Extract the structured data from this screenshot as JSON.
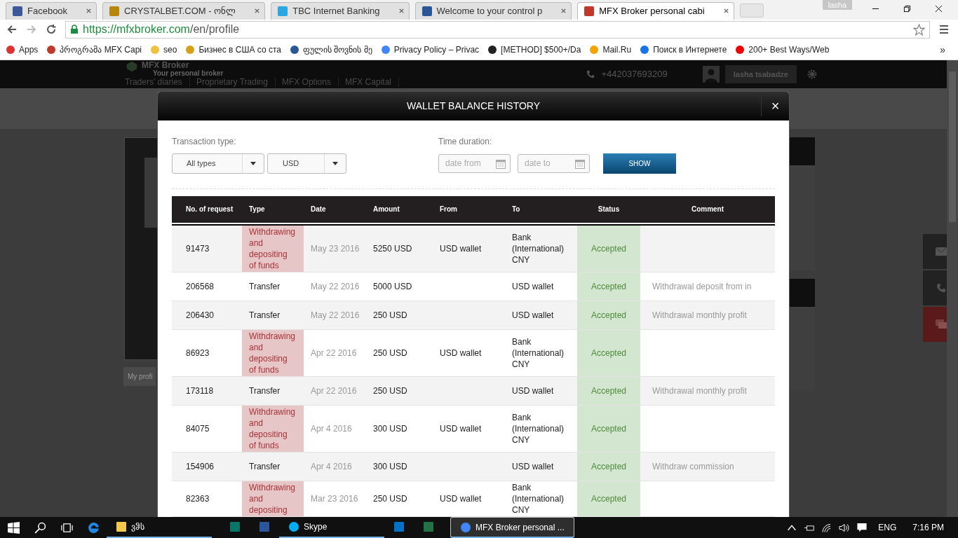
{
  "browser": {
    "tabs": [
      {
        "title": "Facebook",
        "selected": false
      },
      {
        "title": "CRYSTALBET.COM - ონლ",
        "selected": false
      },
      {
        "title": "TBC Internet Banking",
        "selected": false
      },
      {
        "title": "Welcome to your control p",
        "selected": false
      },
      {
        "title": "MFX Broker personal cabi",
        "selected": true
      }
    ],
    "profile": "lasha",
    "url_host": "https://mfxbroker.com",
    "url_path": "/en/profile",
    "bookmarks": [
      "Apps",
      "პროგრამა MFX Capi",
      "seo",
      "Бизнес в США со ста",
      "ფულის შოვნის მე",
      "Privacy Policy – Privac",
      "[METHOD] $500+/Da",
      "Mail.Ru",
      "Поиск в Интернете",
      "200+ Best Ways/Web"
    ],
    "bookmarks_more": "»"
  },
  "page": {
    "logo_name": "MFX Broker",
    "logo_tagline": "Your personal broker",
    "nav": [
      "Traders' diaries",
      "Proprietary Trading",
      "MFX Options",
      "MFX Capital"
    ],
    "phone": "+442037693209",
    "user": "lasha tsabadze",
    "profile_tab": "My profi"
  },
  "modal": {
    "title": "WALLET BALANCE HISTORY",
    "close": "×",
    "type_label": "Transaction type:",
    "type_value": "All types",
    "currency_value": "USD",
    "duration_label": "Time duration:",
    "date_from": {
      "placeholder": "date from"
    },
    "date_to": {
      "placeholder": "date to"
    },
    "show_button": "SHOW",
    "columns": [
      "No. of request",
      "Type",
      "Date",
      "Amount",
      "From",
      "To",
      "Status",
      "Comment"
    ],
    "rows": [
      {
        "id": "91473",
        "kind": "withdrawal",
        "type": "Withdrawing and depositing of funds",
        "date": "May 23 2016",
        "amount": "5250 USD",
        "from": "USD wallet",
        "to": "Bank (International) CNY",
        "status": "Accepted"
      },
      {
        "id": "206568",
        "kind": "transfer",
        "type": "Transfer",
        "date": "May 22 2016",
        "amount": "5000 USD",
        "to": "USD wallet",
        "status": "Accepted",
        "comment": "Withdrawal deposit from in"
      },
      {
        "id": "206430",
        "kind": "transfer",
        "type": "Transfer",
        "date": "May 22 2016",
        "amount": "250 USD",
        "to": "USD wallet",
        "status": "Accepted",
        "comment": "Withdrawal monthly profit"
      },
      {
        "id": "86923",
        "kind": "withdrawal",
        "type": "Withdrawing and depositing of funds",
        "date": "Apr 22 2016",
        "amount": "250 USD",
        "from": "USD wallet",
        "to": "Bank (International) CNY",
        "status": "Accepted"
      },
      {
        "id": "173118",
        "kind": "transfer",
        "type": "Transfer",
        "date": "Apr 22 2016",
        "amount": "250 USD",
        "to": "USD wallet",
        "status": "Accepted",
        "comment": "Withdrawal monthly profit"
      },
      {
        "id": "84075",
        "kind": "withdrawal",
        "type": "Withdrawing and depositing of funds",
        "date": "Apr 4 2016",
        "amount": "300 USD",
        "from": "USD wallet",
        "to": "Bank (International) CNY",
        "status": "Accepted"
      },
      {
        "id": "154906",
        "kind": "transfer",
        "type": "Transfer",
        "date": "Apr 4 2016",
        "amount": "300 USD",
        "to": "USD wallet",
        "status": "Accepted",
        "comment": "Withdraw commission"
      },
      {
        "id": "82363",
        "kind": "withdrawal",
        "type": "Withdrawing and depositing",
        "date": "Mar 23 2016",
        "amount": "250 USD",
        "from": "USD wallet",
        "to": "Bank (International) CNY",
        "status": "Accepted"
      }
    ]
  },
  "taskbar": {
    "items": [
      {
        "kind": "folder",
        "label": "ვჵს",
        "running": true,
        "selected": false
      },
      {
        "kind": "publisher",
        "running": false,
        "selected": false
      },
      {
        "kind": "word",
        "running": false,
        "selected": false
      },
      {
        "kind": "skype",
        "label": "Skype",
        "running": true,
        "selected": false
      },
      {
        "kind": "outlook",
        "running": false,
        "selected": false
      },
      {
        "kind": "excel",
        "running": false,
        "selected": false
      },
      {
        "kind": "chrome",
        "label": "MFX Broker personal ...",
        "running": true,
        "selected": true
      }
    ],
    "language": "ENG",
    "time": "7:16 PM"
  }
}
